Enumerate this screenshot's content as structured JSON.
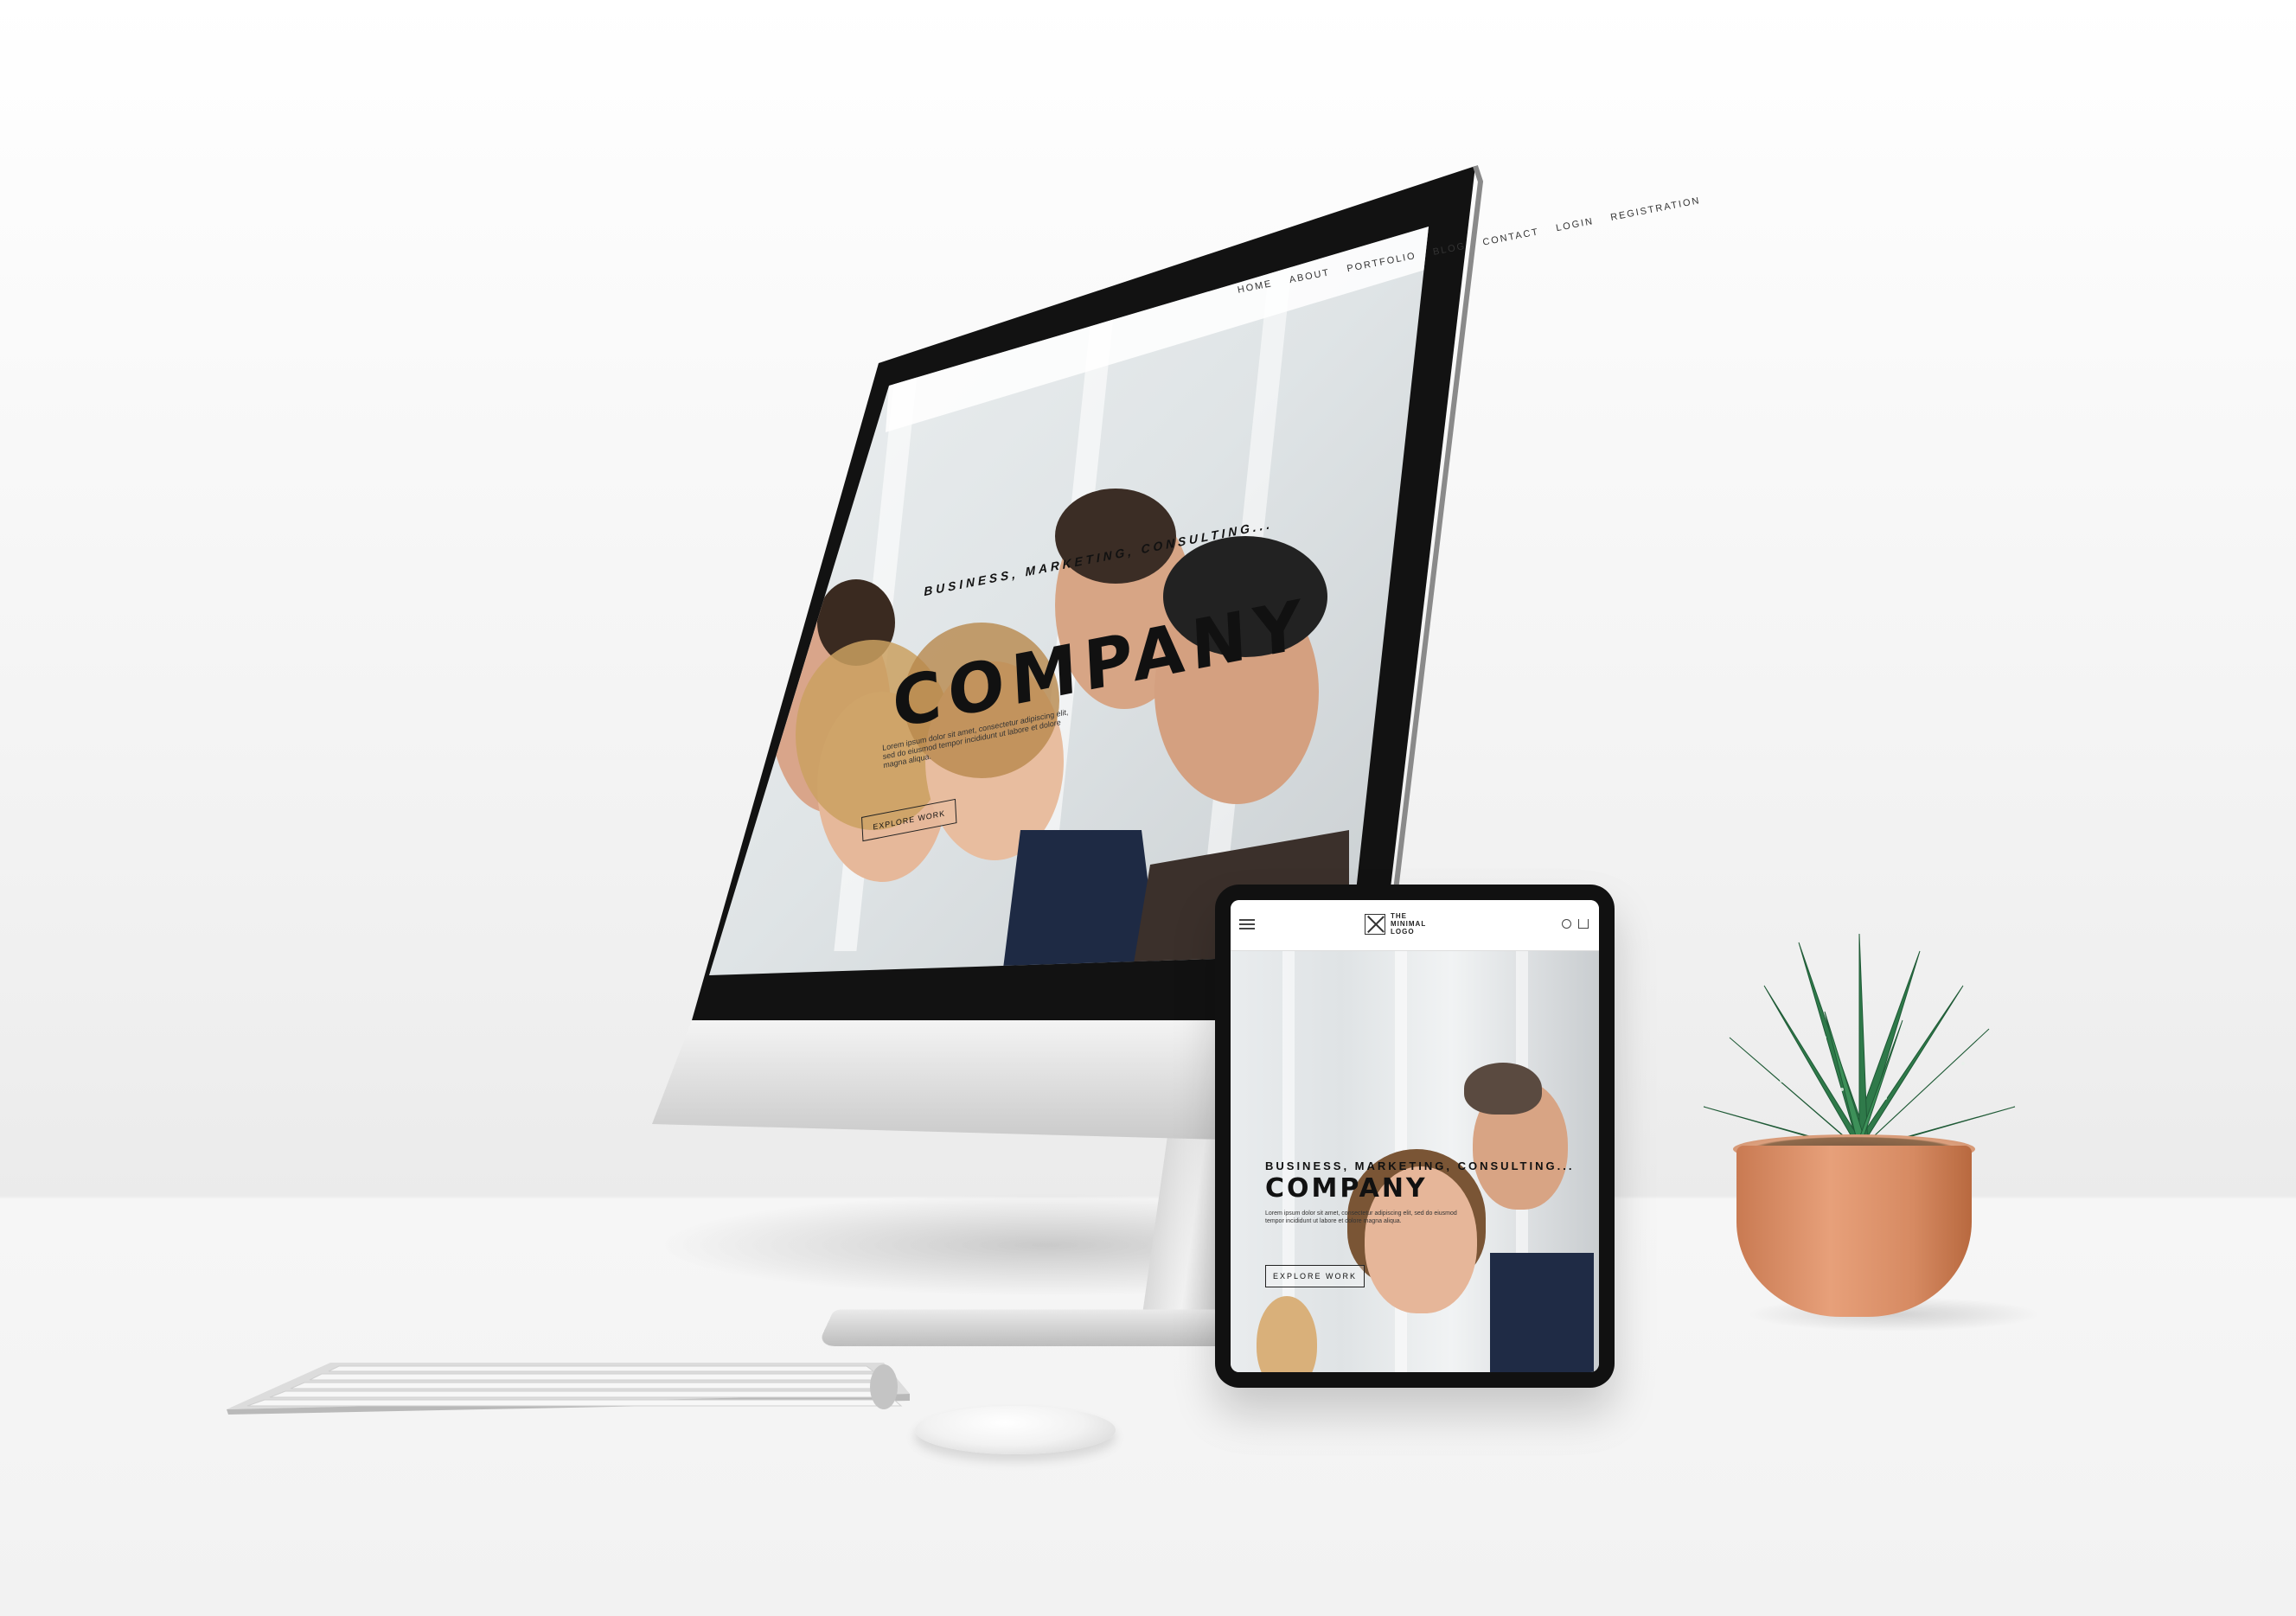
{
  "monitor": {
    "nav_items": [
      "HOME",
      "ABOUT",
      "PORTFOLIO",
      "BLOG",
      "CONTACT",
      "LOGIN",
      "REGISTRATION"
    ],
    "tagline": "BUSINESS, MARKETING, CONSULTING...",
    "title": "COMPANY",
    "body": "Lorem ipsum dolor sit amet, consectetur adipiscing elit, sed do eiusmod tempor incididunt ut labore et dolore magna aliqua.",
    "cta": "EXPLORE WORK"
  },
  "tablet": {
    "logo_text": "THE MINIMAL LOGO",
    "tagline": "BUSINESS, MARKETING, CONSULTING...",
    "title": "COMPANY",
    "body": "Lorem ipsum dolor sit amet, consectetur adipiscing elit, sed do eiusmod tempor incididunt ut labore et dolore magna aliqua.",
    "cta": "EXPLORE WORK"
  },
  "colors": {
    "background": "#f2f2f2",
    "device_frame": "#111111",
    "aluminium": "#d9d9d9",
    "pot": "#e09470",
    "plant_green": "#2f7a4a"
  },
  "icons": [
    "menu-icon",
    "logo-icon",
    "search-icon",
    "cart-icon"
  ]
}
